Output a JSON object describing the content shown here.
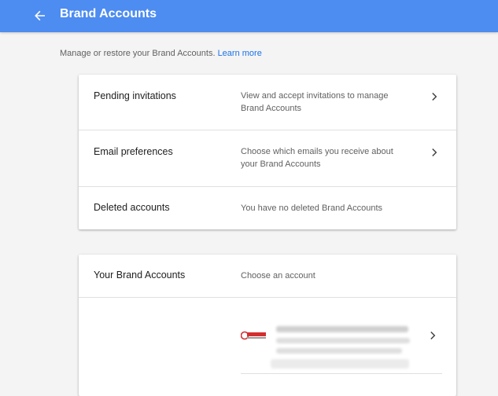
{
  "header": {
    "title": "Brand Accounts",
    "back_icon": "arrow-back-icon",
    "color": "#4d8cf0"
  },
  "intro": {
    "text": "Manage or restore your Brand Accounts.",
    "link": "Learn more",
    "link_color": "#1a73e8"
  },
  "settings": {
    "rows": [
      {
        "label": "Pending invitations",
        "description": "View and accept invitations to manage Brand Accounts",
        "icon": "chevron-right-icon"
      },
      {
        "label": "Email preferences",
        "description": "Choose which emails you receive about your Brand Accounts",
        "icon": "chevron-right-icon"
      },
      {
        "label": "Deleted accounts",
        "description": "You have no deleted Brand Accounts"
      }
    ]
  },
  "brand_accounts": {
    "label": "Your Brand Accounts",
    "description": "Choose an account",
    "account_icon": "chevron-right-icon"
  }
}
